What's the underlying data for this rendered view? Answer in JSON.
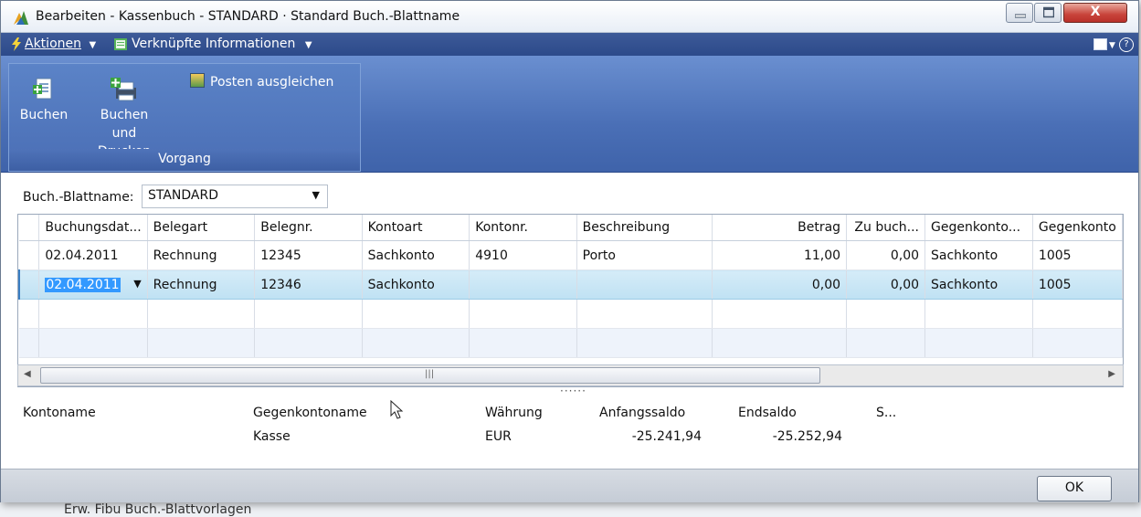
{
  "window": {
    "title": "Bearbeiten - Kassenbuch - STANDARD · Standard Buch.-Blattname",
    "close_glyph": "X"
  },
  "menubar": {
    "actions": "Aktionen",
    "related": "Verknüpfte Informationen"
  },
  "ribbon": {
    "buttons": {
      "post": "Buchen",
      "post_print": "Buchen und Drucken",
      "apply_entries": "Posten ausgleichen"
    },
    "group_label": "Vorgang"
  },
  "batch": {
    "label": "Buch.-Blattname:",
    "value": "STANDARD"
  },
  "table": {
    "columns": [
      "Buchungsdat...",
      "Belegart",
      "Belegnr.",
      "Kontoart",
      "Kontonr.",
      "Beschreibung",
      "Betrag",
      "Zu buch...",
      "Gegenkonto...",
      "Gegenkonto"
    ],
    "rows": [
      [
        "02.04.2011",
        "Rechnung",
        "12345",
        "Sachkonto",
        "4910",
        "Porto",
        "11,00",
        "0,00",
        "Sachkonto",
        "1005"
      ],
      [
        "02.04.2011",
        "Rechnung",
        "12346",
        "Sachkonto",
        "",
        "",
        "0,00",
        "0,00",
        "Sachkonto",
        "1005"
      ]
    ]
  },
  "footer": {
    "account_name_label": "Kontoname",
    "balacc_name_label": "Gegenkontoname",
    "balacc_name_value": "Kasse",
    "currency_label": "Währung",
    "currency_value": "EUR",
    "opening_label": "Anfangssaldo",
    "opening_value": "-25.241,94",
    "ending_label": "Endsaldo",
    "ending_value": "-25.252,94",
    "s_label": "S..."
  },
  "buttons": {
    "ok": "OK"
  },
  "background": {
    "text": "Erw. Fibu Buch.-Blattvorlagen"
  },
  "colors": {
    "menubar": "#2c4a8a",
    "ribbon": "#4a6fb6",
    "selection": "#bfe1f3"
  }
}
